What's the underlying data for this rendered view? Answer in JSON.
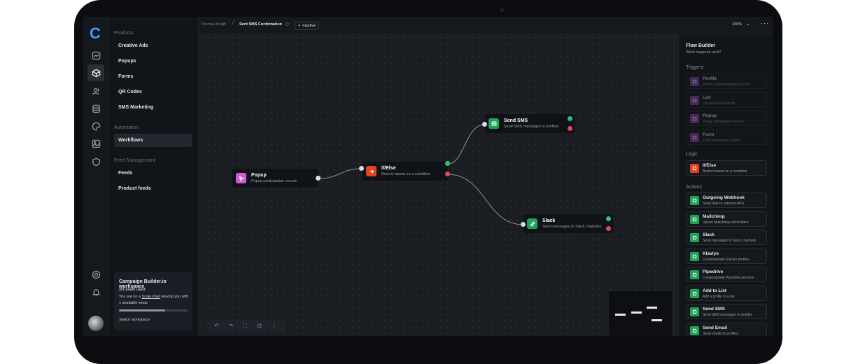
{
  "header": {
    "breadcrumb_owner": "Thomas Kragh",
    "breadcrumb_sep": "/",
    "workflow_name": "Sent SMS Confirmation",
    "status_label": "Inactive",
    "zoom": "100%"
  },
  "brand": {
    "logo_letter": "C"
  },
  "sidebar": {
    "products_title": "Products",
    "products": [
      "Creative Ads",
      "Popups",
      "Forms",
      "QR Codes",
      "SMS Marketing"
    ],
    "automation_title": "Automation",
    "automation": [
      "Workflows"
    ],
    "feed_title": "Feed Management",
    "feed": [
      "Feeds",
      "Product feeds"
    ],
    "active_item": "Workflows"
  },
  "workspace": {
    "name": "Campaign Builder.io workspace",
    "seats": "2/3 seats used",
    "note_prefix": "You are on a ",
    "plan_link": "Scale Plan",
    "note_suffix": " leaving you with 1 available seats",
    "seat_fraction": 0.67,
    "switch_label": "Switch workspace"
  },
  "canvas": {
    "nodes": {
      "popup": {
        "title": "Popup",
        "desc": "Popup participation events",
        "color": "#d55ad8"
      },
      "ifelse": {
        "title": "If/Else",
        "desc": "Branch based on a condition",
        "color": "#e5401f"
      },
      "sms": {
        "title": "Send SMS",
        "desc": "Send SMS messages to profiles",
        "color": "#1fa35a"
      },
      "slack": {
        "title": "Slack",
        "desc": "Send messages to Slack channels",
        "color": "#1fa35a"
      }
    },
    "toolbar": [
      "undo-icon",
      "redo-icon",
      "fit-view-icon",
      "lock-icon",
      "more-vertical-icon"
    ]
  },
  "panel": {
    "title": "Flow Builder",
    "subtitle": "What happens next?",
    "triggers_title": "Triggers",
    "triggers": [
      {
        "title": "Profile",
        "desc": "Profile created/updated events"
      },
      {
        "title": "List",
        "desc": "List join/leave events"
      },
      {
        "title": "Popup",
        "desc": "Popup participation events"
      },
      {
        "title": "Form",
        "desc": "Form submission events"
      }
    ],
    "logic_title": "Logic",
    "logic": [
      {
        "title": "If/Else",
        "desc": "Branch based on a condition"
      }
    ],
    "actions_title": "Actions",
    "actions": [
      {
        "title": "Outgoing Webhook",
        "desc": "Send data to external APIs"
      },
      {
        "title": "Mailchimp",
        "desc": "Upsert Mailchimp subscribers"
      },
      {
        "title": "Slack",
        "desc": "Send messages to Slack channels"
      },
      {
        "title": "Klaviyo",
        "desc": "Create/update Klaviyo profiles"
      },
      {
        "title": "Pipedrive",
        "desc": "Create/update Pipedrive persons"
      },
      {
        "title": "Add to List",
        "desc": "Add a profile to a list"
      },
      {
        "title": "Send SMS",
        "desc": "Send SMS messages to profiles"
      },
      {
        "title": "Send Email",
        "desc": "Send emails to profiles"
      }
    ],
    "trigger_color": "#8e44ad",
    "logic_color": "#e5401f",
    "action_color": "#1fa35a"
  }
}
